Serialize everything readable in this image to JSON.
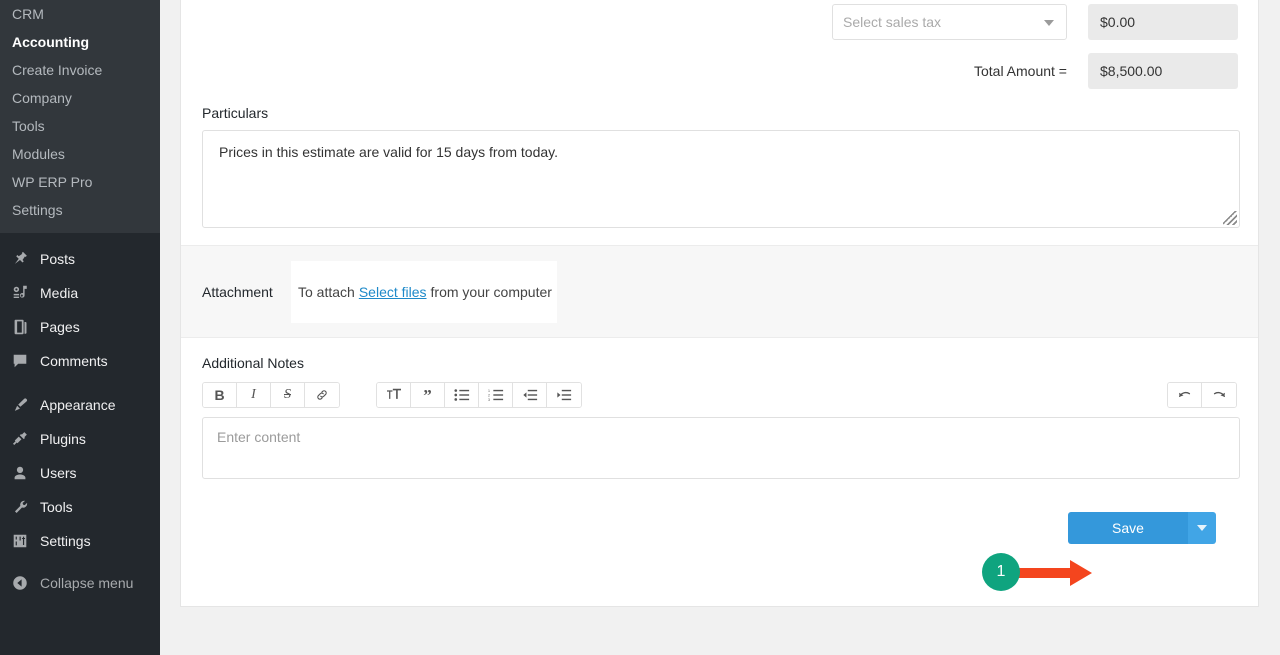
{
  "sidebar": {
    "submenu": [
      {
        "label": "CRM",
        "active": false
      },
      {
        "label": "Accounting",
        "active": true
      },
      {
        "label": "Create Invoice",
        "active": false
      },
      {
        "label": "Company",
        "active": false
      },
      {
        "label": "Tools",
        "active": false
      },
      {
        "label": "Modules",
        "active": false
      },
      {
        "label": "WP ERP Pro",
        "active": false
      },
      {
        "label": "Settings",
        "active": false
      }
    ],
    "menu": [
      {
        "label": "Posts",
        "icon": "pin-icon"
      },
      {
        "label": "Media",
        "icon": "media-icon"
      },
      {
        "label": "Pages",
        "icon": "pages-icon"
      },
      {
        "label": "Comments",
        "icon": "comments-icon"
      },
      {
        "label": "Appearance",
        "icon": "brush-icon"
      },
      {
        "label": "Plugins",
        "icon": "plug-icon"
      },
      {
        "label": "Users",
        "icon": "user-icon"
      },
      {
        "label": "Tools",
        "icon": "wrench-icon"
      },
      {
        "label": "Settings",
        "icon": "sliders-icon"
      },
      {
        "label": "Collapse menu",
        "icon": "collapse-icon"
      }
    ]
  },
  "form": {
    "sales_tax_placeholder": "Select sales tax",
    "tax_amount": "$0.00",
    "total_amount_label": "Total Amount =",
    "total_amount_value": "$8,500.00",
    "particulars_label": "Particulars",
    "particulars_value": "Prices in this estimate are valid for 15 days from today.",
    "attachment_label": "Attachment",
    "attachment_prefix": "To attach",
    "attachment_link": "Select files",
    "attachment_suffix": "from your computer",
    "notes_label": "Additional Notes",
    "notes_placeholder": "Enter content"
  },
  "toolbar": {
    "bold": "B",
    "italic": "I",
    "strikethrough": "S",
    "link": "link-icon",
    "text_size": "text-size-icon",
    "blockquote": "”",
    "bullet_list": "bullet-list-icon",
    "numbered_list": "numbered-list-icon",
    "outdent": "outdent-icon",
    "indent": "indent-icon",
    "undo": "undo-icon",
    "redo": "redo-icon"
  },
  "actions": {
    "save_label": "Save",
    "save_dropdown": "chevron-down-icon"
  },
  "annotation": {
    "step_number": "1"
  },
  "colors": {
    "sidebar_bg": "#23282d",
    "submenu_bg": "#32373c",
    "primary_blue": "#3498db",
    "link_blue": "#1d89c9",
    "annotation_teal": "#0fa47f",
    "annotation_orange": "#f4451e",
    "page_bg": "#f1f1f1"
  }
}
